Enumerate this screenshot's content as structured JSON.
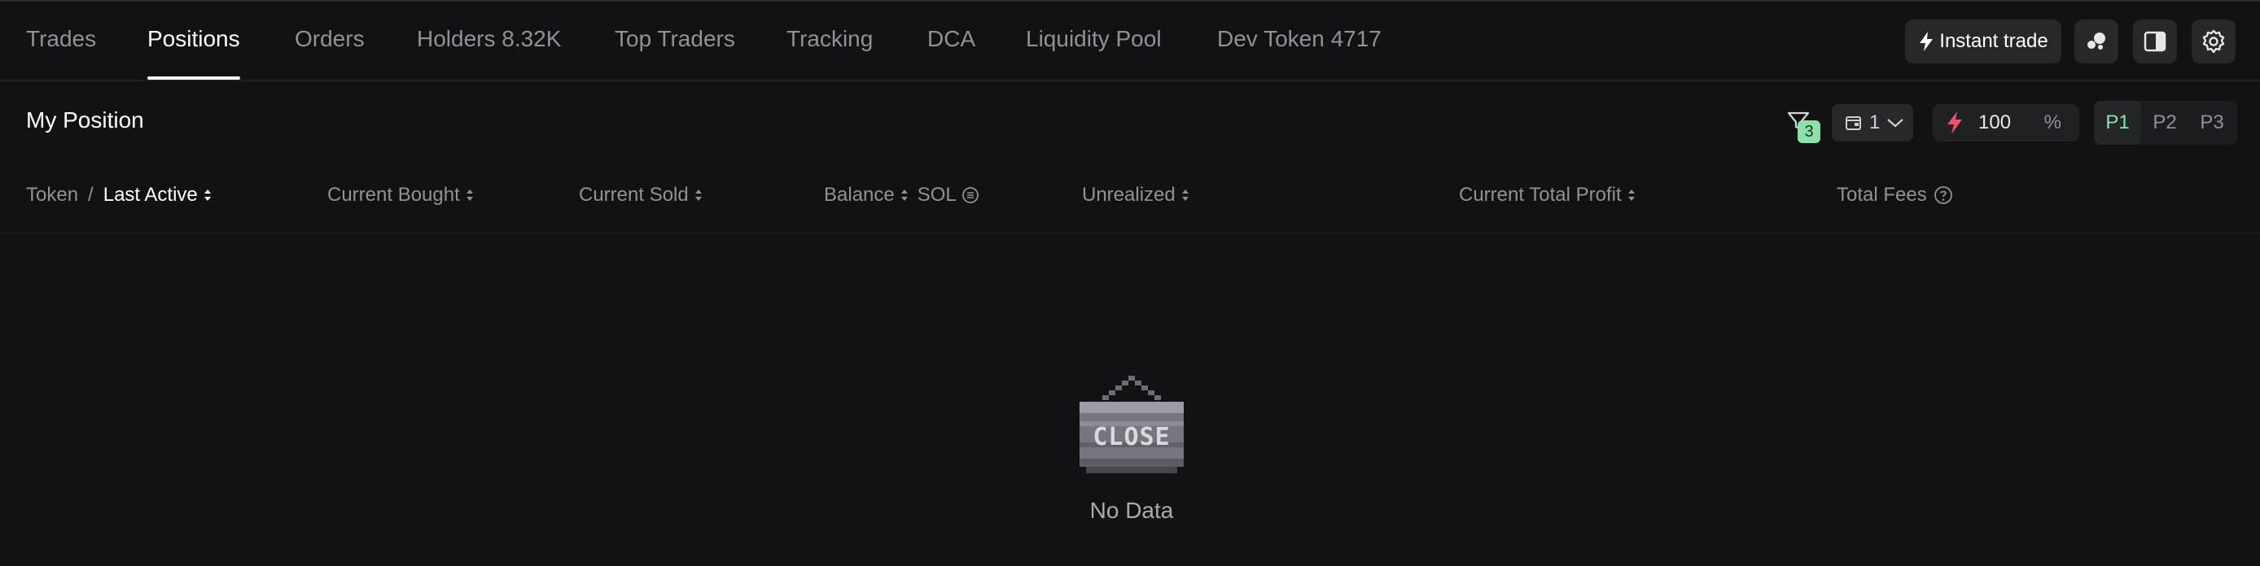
{
  "tabs": [
    {
      "label": "Trades"
    },
    {
      "label": "Positions"
    },
    {
      "label": "Orders"
    },
    {
      "label": "Holders 8.32K"
    },
    {
      "label": "Top Traders"
    },
    {
      "label": "Tracking"
    },
    {
      "label": "DCA"
    },
    {
      "label": "Liquidity Pool"
    },
    {
      "label": "Dev Token 4717"
    }
  ],
  "active_tab": "Positions",
  "toolbar": {
    "instant_trade_label": "Instant trade",
    "icons": [
      "bubbles-icon",
      "panel-icon",
      "gear-icon"
    ]
  },
  "position": {
    "title": "My Position",
    "filter_count": "3",
    "wallet_value": "1",
    "amount_value": "100",
    "amount_unit": "%",
    "presets": [
      "P1",
      "P2",
      "P3"
    ],
    "active_preset": "P1"
  },
  "columns": {
    "token": "Token",
    "separator": "/",
    "last_active": "Last Active",
    "current_bought": "Current Bought",
    "current_sold": "Current Sold",
    "balance": "Balance",
    "sol": "SOL",
    "unrealized": "Unrealized",
    "current_total_profit": "Current Total Profit",
    "total_fees": "Total Fees"
  },
  "empty_state": {
    "sign_text": "CLOSE",
    "message": "No Data"
  },
  "colors": {
    "background": "#111214",
    "accent_green": "#8fe0a8",
    "lightning_red": "#f0506e",
    "button_bg": "#26282c"
  }
}
